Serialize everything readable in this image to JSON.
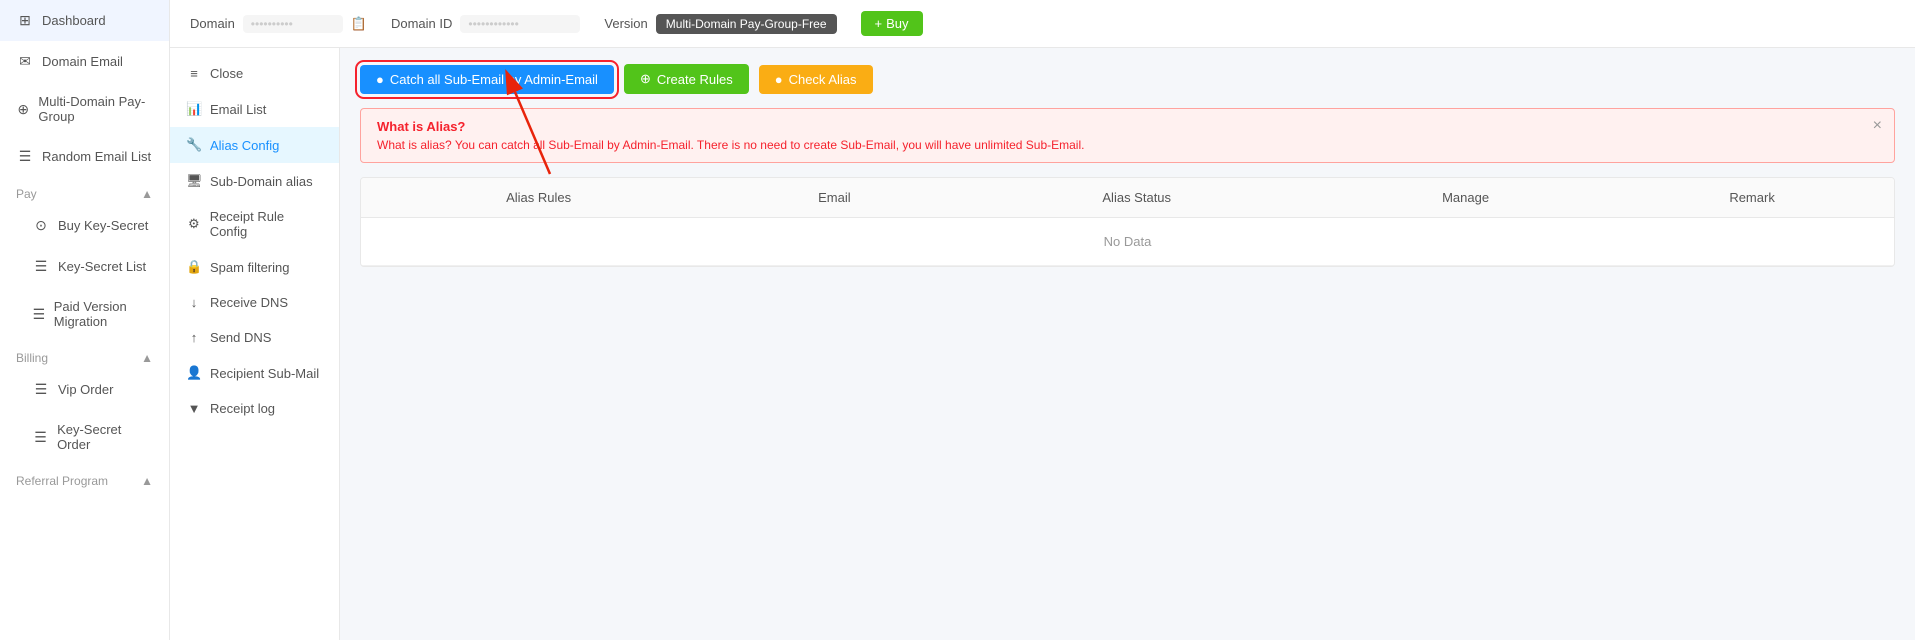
{
  "sidebar": {
    "items": [
      {
        "id": "dashboard",
        "label": "Dashboard",
        "icon": "⊞"
      },
      {
        "id": "domain-email",
        "label": "Domain Email",
        "icon": "✉"
      },
      {
        "id": "multi-domain",
        "label": "Multi-Domain Pay-Group",
        "icon": "⊕"
      },
      {
        "id": "random-email",
        "label": "Random Email List",
        "icon": "☰"
      }
    ],
    "pay_group": {
      "label": "Pay",
      "icon": "▲"
    },
    "pay_items": [
      {
        "id": "buy-key-secret",
        "label": "Buy Key-Secret",
        "icon": "⊙"
      },
      {
        "id": "key-secret-list",
        "label": "Key-Secret List",
        "icon": "☰"
      },
      {
        "id": "paid-version-migration",
        "label": "Paid Version Migration",
        "icon": "☰"
      }
    ],
    "billing_group": {
      "label": "Billing",
      "icon": "▲"
    },
    "billing_items": [
      {
        "id": "vip-order",
        "label": "Vip Order",
        "icon": "☰"
      },
      {
        "id": "key-secret-order",
        "label": "Key-Secret Order",
        "icon": "☰"
      }
    ],
    "referral_group": {
      "label": "Referral Program",
      "icon": "▲"
    }
  },
  "header": {
    "domain_label": "Domain",
    "domain_value": "••••••••••",
    "domain_id_label": "Domain ID",
    "domain_id_value": "••••••••••••",
    "version_label": "Version",
    "version_badge": "Multi-Domain Pay-Group-Free",
    "buy_label": "Buy",
    "buy_icon": "+"
  },
  "secondary_sidebar": {
    "items": [
      {
        "id": "close",
        "label": "Close",
        "icon": "≡"
      },
      {
        "id": "email-list",
        "label": "Email List",
        "icon": "📊"
      },
      {
        "id": "alias-config",
        "label": "Alias Config",
        "icon": "🔧",
        "active": true
      },
      {
        "id": "sub-domain-alias",
        "label": "Sub-Domain alias",
        "icon": "🖥"
      },
      {
        "id": "receipt-rule-config",
        "label": "Receipt Rule Config",
        "icon": "⚙"
      },
      {
        "id": "spam-filtering",
        "label": "Spam filtering",
        "icon": "🔒"
      },
      {
        "id": "receive-dns",
        "label": "Receive DNS",
        "icon": "↓"
      },
      {
        "id": "send-dns",
        "label": "Send DNS",
        "icon": "↑"
      },
      {
        "id": "recipient-sub-mail",
        "label": "Recipient Sub-Mail",
        "icon": "👤"
      },
      {
        "id": "receipt-log",
        "label": "Receipt log",
        "icon": "▼"
      }
    ]
  },
  "toolbar": {
    "catch_all_label": "Catch all Sub-Email by Admin-Email",
    "catch_all_icon": "●",
    "create_rules_label": "Create Rules",
    "create_rules_icon": "⊕",
    "check_alias_label": "Check Alias",
    "check_alias_icon": "●"
  },
  "alert": {
    "title": "What is Alias?",
    "close_icon": "×",
    "text": "What is alias? You can catch all Sub-Email by Admin-Email. There is no need to create Sub-Email, you will have unlimited Sub-Email."
  },
  "table": {
    "columns": [
      "Alias Rules",
      "Email",
      "Alias Status",
      "Manage",
      "Remark"
    ],
    "no_data": "No Data"
  },
  "colors": {
    "primary": "#1890ff",
    "success": "#52c41a",
    "warning": "#faad14",
    "danger": "#f5222d",
    "version_bg": "#666"
  }
}
